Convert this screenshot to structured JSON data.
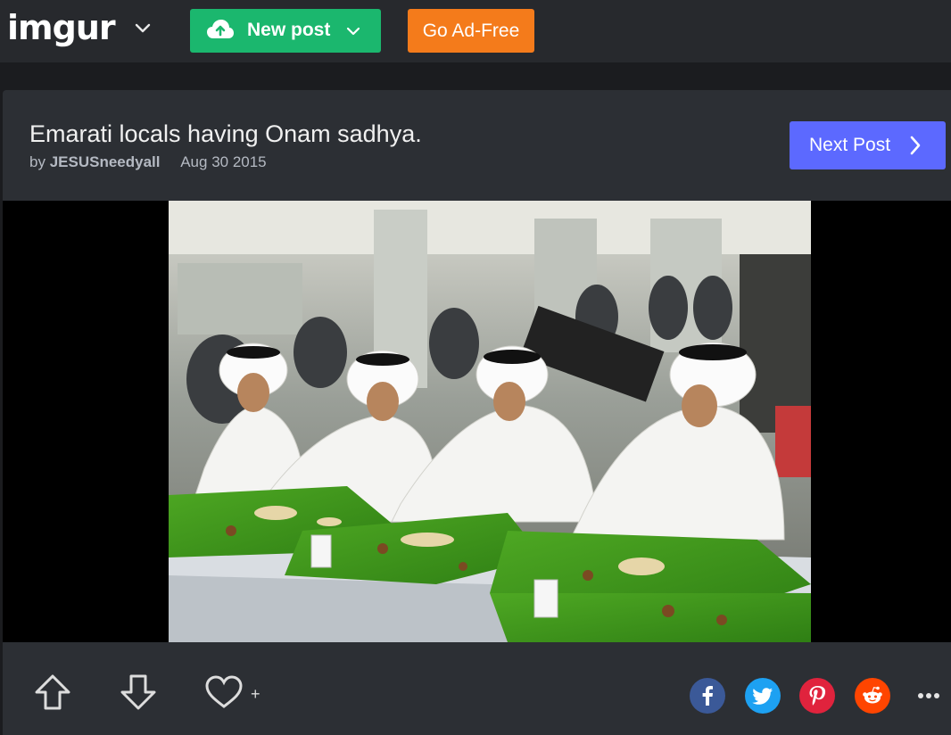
{
  "header": {
    "logo_text": "imgur",
    "new_post_label": "New post",
    "ad_free_label": "Go Ad-Free"
  },
  "post": {
    "title": "Emarati locals having Onam sadhya.",
    "by_label": "by",
    "author": "JESUSneedyall",
    "date": "Aug 30 2015",
    "next_label": "Next Post"
  },
  "actions": {
    "favorite_plus": "+"
  },
  "colors": {
    "new_post": "#1bb76e",
    "ad_free": "#f47b1b",
    "next_post": "#5c69ff",
    "facebook": "#3b5998",
    "twitter": "#1da1f2",
    "pinterest": "#e0233d",
    "reddit": "#ff4500"
  },
  "icons": {
    "logo_menu": "chevron-down-icon",
    "new_post": "cloud-upload-icon",
    "new_post_menu": "chevron-down-icon",
    "next": "chevron-right-icon",
    "upvote": "arrow-up-icon",
    "downvote": "arrow-down-icon",
    "favorite": "heart-icon",
    "share": [
      "facebook-icon",
      "twitter-icon",
      "pinterest-icon",
      "reddit-icon"
    ],
    "more": "more-dots-icon"
  }
}
